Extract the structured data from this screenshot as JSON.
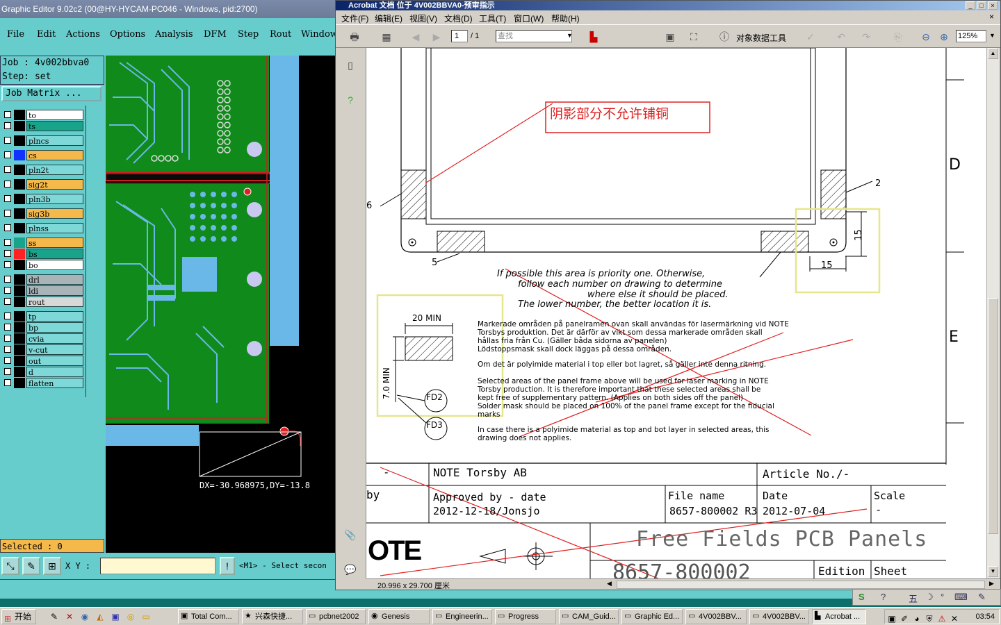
{
  "genesis": {
    "title": "Graphic Editor 9.02c2 (00@HY-HYCAM-PC046 - Windows, pid:2700)",
    "menu": [
      "File",
      "Edit",
      "Actions",
      "Options",
      "Analysis",
      "DFM",
      "Step",
      "Rout",
      "Window"
    ],
    "job": "Job : 4v002bbva0",
    "step": "Step: set",
    "job_matrix_button": "Job Matrix ...",
    "layers": [
      {
        "name": "to",
        "bg": "#ffffff",
        "sw": "#000000"
      },
      {
        "name": "ts",
        "bg": "#19a38a",
        "sw": "#000000"
      },
      {
        "name": "plncs",
        "bg": "#7fd8d8",
        "sw": "#000000"
      },
      {
        "name": "cs",
        "bg": "#f5b84a",
        "sw": "#1133ff"
      },
      {
        "name": "pln2t",
        "bg": "#7fd8d8",
        "sw": "#000000"
      },
      {
        "name": "sig2t",
        "bg": "#f5b84a",
        "sw": "#000000"
      },
      {
        "name": "pln3b",
        "bg": "#7fd8d8",
        "sw": "#000000"
      },
      {
        "name": "sig3b",
        "bg": "#f5b84a",
        "sw": "#000000"
      },
      {
        "name": "plnss",
        "bg": "#7fd8d8",
        "sw": "#000000"
      },
      {
        "name": "ss",
        "bg": "#f5b84a",
        "sw": "#19a38a"
      },
      {
        "name": "bs",
        "bg": "#19a38a",
        "sw": "#ff2222"
      },
      {
        "name": "bo",
        "bg": "#ffffff",
        "sw": "#000000"
      },
      {
        "name": "drl",
        "bg": "#a8b4b8",
        "sw": "#000000"
      },
      {
        "name": "ldi",
        "bg": "#a8b4b8",
        "sw": "#000000"
      },
      {
        "name": "rout",
        "bg": "#d8d8d8",
        "sw": "#000000"
      },
      {
        "name": "tp",
        "bg": "#7fd8d8",
        "sw": "#000000"
      },
      {
        "name": "bp",
        "bg": "#7fd8d8",
        "sw": "#000000"
      },
      {
        "name": "cvia",
        "bg": "#7fd8d8",
        "sw": "#000000"
      },
      {
        "name": "v-cut",
        "bg": "#7fd8d8",
        "sw": "#000000"
      },
      {
        "name": "out",
        "bg": "#7fd8d8",
        "sw": "#000000"
      },
      {
        "name": "d",
        "bg": "#7fd8d8",
        "sw": "#000000"
      },
      {
        "name": "flatten",
        "bg": "#7fd8d8",
        "sw": "#000000"
      }
    ],
    "selected": "Selected : 0",
    "xy_label": "X Y :",
    "xy_value": "",
    "m1_prompt": "<M1> - Select secon",
    "dx_dy": "DX=-30.968975,DY=-13.8"
  },
  "acrobat": {
    "title": "Acrobat 文档 位于 4V002BBVA0-预审指示",
    "menu": [
      "文件(F)",
      "编辑(E)",
      "视图(V)",
      "文档(D)",
      "工具(T)",
      "窗口(W)",
      "帮助(H)"
    ],
    "page_current": "1",
    "page_total": "/ 1",
    "find_placeholder": "查找",
    "object_tool": "对象数据工具",
    "zoom": "125%",
    "page_size": "20.996 x 29.700 厘米",
    "doc": {
      "callout": "阴影部分不允许铺铜",
      "dim_2": "2",
      "dim_6": "6",
      "dim_5": "5",
      "dim_15a": "15",
      "dim_15b": "15",
      "side_d": "D",
      "side_e": "E",
      "priority": [
        "If possible this area is priority one. Otherwise,",
        "follow each number on drawing to determine",
        "where else it should be placed.",
        "The lower number, the better location it is."
      ],
      "min20": "20 MIN",
      "min7": "7.0 MIN",
      "fd2": "FD2",
      "fd3": "FD3",
      "swedish": [
        "Markerade områden på panelramen ovan skall användas för lasermärkning vid NOTE",
        "Torsbys produktion. Det är därför av vikt som dessa markerade områden skall",
        "hållas fria från Cu. (Gäller båda sidorna av panelen)",
        "Lödstoppsmask skall dock läggas på dessa områden."
      ],
      "swedish2": "Om det är polyimide material i top eller bot lagret, så gäller inte denna ritning.",
      "english": [
        "Selected areas of the panel frame above will be used for laser marking in NOTE",
        "Torsby production. It is therefore important that these selected areas shall be",
        "kept free of supplementary pattern. (Applies on both sides off the panel)",
        "Solder mask should be placed on 100% of the panel frame except for the fiducial",
        "marks"
      ],
      "english2": [
        "In case there is a polyimide material as top and bot layer in selected areas, this",
        "drawing does not applies."
      ],
      "tb_dash": "-",
      "tb_company": "NOTE Torsby AB",
      "tb_article": "Article No./-",
      "tb_by": "by",
      "tb_approved": "Approved by - date",
      "tb_approved_val": "2012-12-18/Jonsjo",
      "tb_filename": "File name",
      "tb_filename_val": "8657-800002 R3",
      "tb_date": "Date",
      "tb_date_val": "2012-07-04",
      "tb_scale": "Scale",
      "tb_scale_val": "-",
      "tb_title": "Free Fields PCB Panels",
      "tb_number": "8657-800002",
      "tb_edition": "Edition",
      "tb_sheet": "Sheet",
      "logo": "OTE"
    }
  },
  "taskbar": {
    "start": "开始",
    "tasks": [
      {
        "label": "Total Com...",
        "icon": "folder-icon"
      },
      {
        "label": "兴森快捷...",
        "icon": "star-icon"
      },
      {
        "label": "pcbnet2002",
        "icon": "window-icon"
      },
      {
        "label": "Genesis",
        "icon": "genesis-icon"
      },
      {
        "label": "Engineerin...",
        "icon": "window-icon"
      },
      {
        "label": "Progress",
        "icon": "window-icon"
      },
      {
        "label": "CAM_Guid...",
        "icon": "window-icon"
      },
      {
        "label": "Graphic Ed...",
        "icon": "window-icon"
      },
      {
        "label": "4V002BBV...",
        "icon": "window-icon"
      },
      {
        "label": "4V002BBV...",
        "icon": "window-icon"
      },
      {
        "label": "Acrobat ...",
        "icon": "acrobat-icon"
      }
    ],
    "clock": "03:54"
  },
  "ime": {
    "items": [
      "S",
      "?",
      "五",
      "☽",
      "°",
      "⌨",
      "✎"
    ]
  }
}
